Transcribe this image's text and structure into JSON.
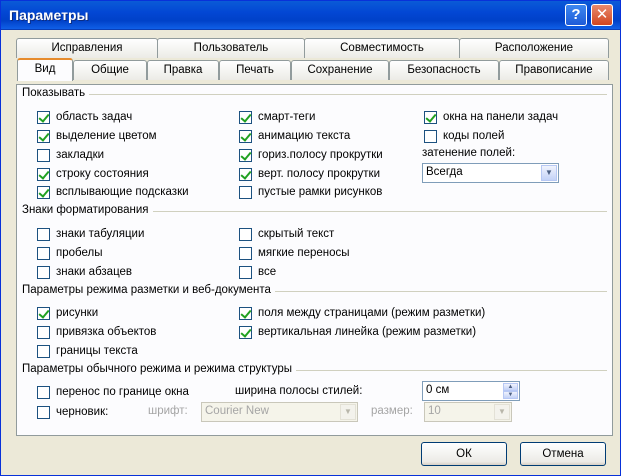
{
  "window": {
    "title": "Параметры",
    "help_glyph": "?",
    "close_glyph": "✕"
  },
  "tabs_back": [
    {
      "label": "Исправления"
    },
    {
      "label": "Пользователь"
    },
    {
      "label": "Совместимость"
    },
    {
      "label": "Расположение"
    }
  ],
  "tabs_front": [
    {
      "label": "Вид"
    },
    {
      "label": "Общие"
    },
    {
      "label": "Правка"
    },
    {
      "label": "Печать"
    },
    {
      "label": "Сохранение"
    },
    {
      "label": "Безопасность"
    },
    {
      "label": "Правописание"
    }
  ],
  "show": {
    "title": "Показывать",
    "items": [
      {
        "label": "область задач",
        "checked": true
      },
      {
        "label": "выделение цветом",
        "checked": true
      },
      {
        "label": "закладки",
        "checked": false
      },
      {
        "label": "строку состояния",
        "checked": true
      },
      {
        "label": "всплывающие подсказки",
        "checked": true
      },
      {
        "label": "смарт-теги",
        "checked": true
      },
      {
        "label": "анимацию текста",
        "checked": true
      },
      {
        "label": "гориз.полосу прокрутки",
        "checked": true
      },
      {
        "label": "верт. полосу прокрутки",
        "checked": true
      },
      {
        "label": "пустые рамки рисунков",
        "checked": false
      },
      {
        "label": "окна на панели задач",
        "checked": true
      },
      {
        "label": "коды полей",
        "checked": false
      }
    ],
    "shading_label": "затенение полей:",
    "shading_value": "Всегда"
  },
  "format": {
    "title": "Знаки форматирования",
    "items": [
      {
        "label": "знаки табуляции",
        "checked": false
      },
      {
        "label": "пробелы",
        "checked": false
      },
      {
        "label": "знаки абзацев",
        "checked": false
      },
      {
        "label": "скрытый текст",
        "checked": false
      },
      {
        "label": "мягкие переносы",
        "checked": false
      },
      {
        "label": "все",
        "checked": false
      }
    ]
  },
  "layout": {
    "title": "Параметры режима разметки и веб-документа",
    "items": [
      {
        "label": "рисунки",
        "checked": true
      },
      {
        "label": "привязка объектов",
        "checked": false
      },
      {
        "label": "границы текста",
        "checked": false
      },
      {
        "label": "поля между страницами (режим разметки)",
        "checked": true
      },
      {
        "label": "вертикальная линейка (режим разметки)",
        "checked": true
      }
    ]
  },
  "normal": {
    "title": "Параметры обычного режима и режима структуры",
    "wrap_label": "перенос по границе окна",
    "wrap_checked": false,
    "draft_label": "черновик:",
    "draft_checked": false,
    "style_width_label": "ширина полосы стилей:",
    "style_width_value": "0 см",
    "font_label": "шрифт:",
    "font_value": "Courier New",
    "size_label": "размер:",
    "size_value": "10"
  },
  "buttons": {
    "ok": "ОК",
    "cancel": "Отмена"
  },
  "icons": {
    "dropdown": "▼",
    "spin_up": "▲",
    "spin_down": "▼"
  }
}
